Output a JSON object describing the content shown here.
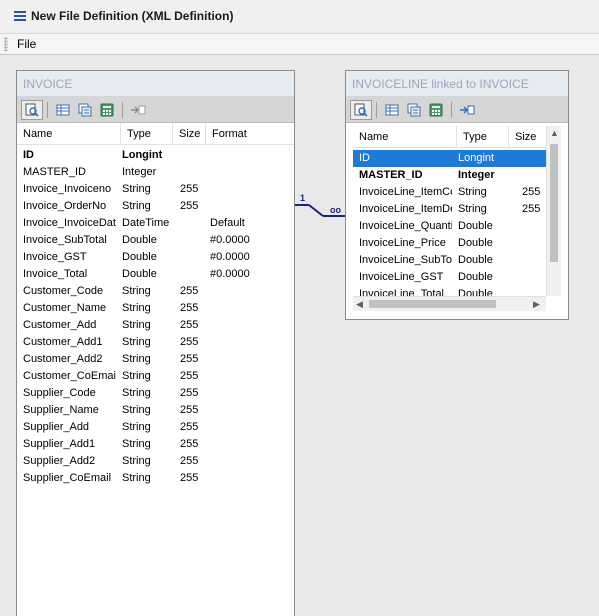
{
  "window": {
    "title": "New File Definition (XML Definition)"
  },
  "menu": {
    "items": [
      "File"
    ]
  },
  "relationship": {
    "one_label": "1",
    "many_label": "oo"
  },
  "invoice": {
    "title": "INVOICE",
    "columns": [
      "Name",
      "Type",
      "Size",
      "Format"
    ],
    "rows": [
      {
        "name": "ID",
        "type": "Longint",
        "size": "",
        "format": "",
        "bold": true
      },
      {
        "name": "MASTER_ID",
        "type": "Integer",
        "size": "",
        "format": ""
      },
      {
        "name": "Invoice_Invoiceno",
        "type": "String",
        "size": "255",
        "format": ""
      },
      {
        "name": "Invoice_OrderNo",
        "type": "String",
        "size": "255",
        "format": ""
      },
      {
        "name": "Invoice_InvoiceDate",
        "type": "DateTime",
        "size": "",
        "format": "Default"
      },
      {
        "name": "Invoice_SubTotal",
        "type": "Double",
        "size": "",
        "format": "#0.0000"
      },
      {
        "name": "Invoice_GST",
        "type": "Double",
        "size": "",
        "format": "#0.0000"
      },
      {
        "name": "Invoice_Total",
        "type": "Double",
        "size": "",
        "format": "#0.0000"
      },
      {
        "name": "Customer_Code",
        "type": "String",
        "size": "255",
        "format": ""
      },
      {
        "name": "Customer_Name",
        "type": "String",
        "size": "255",
        "format": ""
      },
      {
        "name": "Customer_Add",
        "type": "String",
        "size": "255",
        "format": ""
      },
      {
        "name": "Customer_Add1",
        "type": "String",
        "size": "255",
        "format": ""
      },
      {
        "name": "Customer_Add2",
        "type": "String",
        "size": "255",
        "format": ""
      },
      {
        "name": "Customer_CoEmail",
        "type": "String",
        "size": "255",
        "format": ""
      },
      {
        "name": "Supplier_Code",
        "type": "String",
        "size": "255",
        "format": ""
      },
      {
        "name": "Supplier_Name",
        "type": "String",
        "size": "255",
        "format": ""
      },
      {
        "name": "Supplier_Add",
        "type": "String",
        "size": "255",
        "format": ""
      },
      {
        "name": "Supplier_Add1",
        "type": "String",
        "size": "255",
        "format": ""
      },
      {
        "name": "Supplier_Add2",
        "type": "String",
        "size": "255",
        "format": ""
      },
      {
        "name": "Supplier_CoEmail",
        "type": "String",
        "size": "255",
        "format": ""
      }
    ]
  },
  "invoiceline": {
    "title": "INVOICELINE linked to INVOICE",
    "columns": [
      "Name",
      "Type",
      "Size"
    ],
    "rows": [
      {
        "name": "ID",
        "type": "Longint",
        "size": "",
        "selected": true
      },
      {
        "name": "MASTER_ID",
        "type": "Integer",
        "size": "",
        "bold": true
      },
      {
        "name": "InvoiceLine_ItemCode",
        "type": "String",
        "size": "255"
      },
      {
        "name": "InvoiceLine_ItemDesc",
        "type": "String",
        "size": "255"
      },
      {
        "name": "InvoiceLine_Quantity",
        "type": "Double",
        "size": ""
      },
      {
        "name": "InvoiceLine_Price",
        "type": "Double",
        "size": ""
      },
      {
        "name": "InvoiceLine_SubTotal",
        "type": "Double",
        "size": ""
      },
      {
        "name": "InvoiceLine_GST",
        "type": "Double",
        "size": ""
      },
      {
        "name": "InvoiceLine_Total",
        "type": "Double",
        "size": ""
      }
    ]
  },
  "toolbar_icons": [
    "find-field-icon",
    "table-view-icon",
    "properties-icon",
    "calculator-icon",
    "link-field-icon"
  ],
  "colors": {
    "selection": "#1e7ad6",
    "relation_line": "#1a237e",
    "title_text": "#9aa7b8"
  }
}
